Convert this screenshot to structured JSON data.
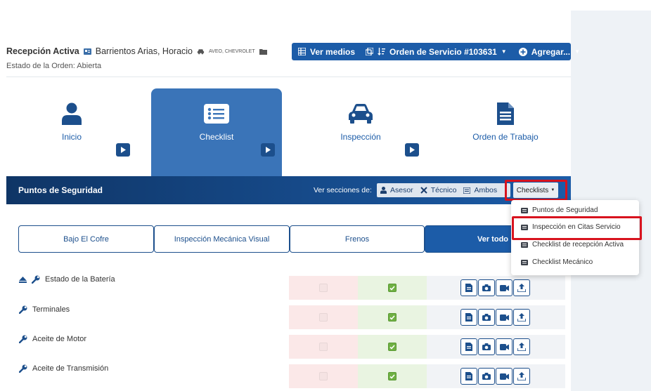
{
  "header": {
    "title": "Recepción Activa",
    "customer": "Barrientos Arias, Horacio",
    "vehicle": "AVEO, CHEVROLET",
    "status": "Estado de la Orden: Abierta"
  },
  "actions": {
    "ver_medios": "Ver medios",
    "orden_servicio": "Orden de Servicio #103631",
    "agregar": "Agregar..."
  },
  "steps": [
    {
      "label": "Inicio",
      "icon": "user-icon"
    },
    {
      "label": "Checklist",
      "icon": "list-icon"
    },
    {
      "label": "Inspección",
      "icon": "car-icon"
    },
    {
      "label": "Orden de Trabajo",
      "icon": "document-icon"
    }
  ],
  "section": {
    "title": "Puntos de Seguridad",
    "ver_secciones": "Ver secciones de:",
    "asesor": "Asesor",
    "tecnico": "Técnico",
    "ambos": "Ambos",
    "checklists": "Checklists"
  },
  "dropdown": {
    "items": [
      "Puntos de Seguridad",
      "Inspección en Citas Servicio",
      "Checklist de recepción Activa",
      "Checklist Mecánico"
    ]
  },
  "tabs": [
    "Bajo El Cofre",
    "Inspección Mecánica Visual",
    "Frenos",
    "Ver todo"
  ],
  "rows": [
    {
      "label": "Estado de la Batería",
      "bad": false,
      "good": true
    },
    {
      "label": "Terminales",
      "bad": false,
      "good": true
    },
    {
      "label": "Aceite de Motor",
      "bad": false,
      "good": true
    },
    {
      "label": "Aceite de Transmisión",
      "bad": false,
      "good": true
    }
  ],
  "colors": {
    "primary": "#1c5ca8",
    "highlight": "#d8131e",
    "ok": "#6fb043"
  }
}
